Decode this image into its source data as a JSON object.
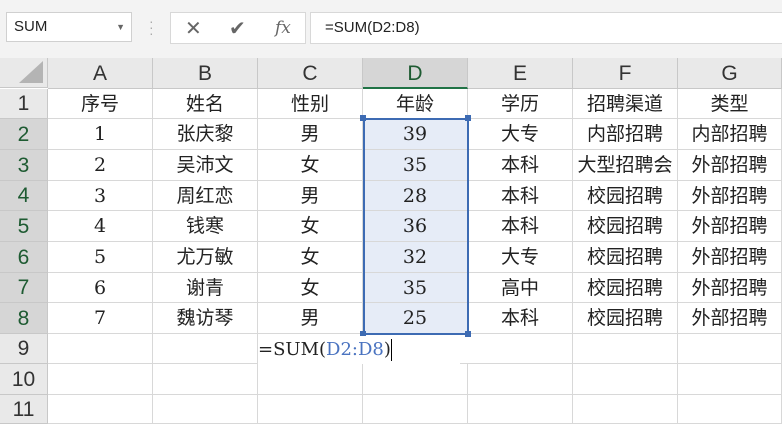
{
  "name_box": "SUM",
  "formula_bar": "=SUM(D2:D8)",
  "formula_buttons": {
    "cancel": "✕",
    "enter": "✔",
    "fx": "fx"
  },
  "columns": [
    "A",
    "B",
    "C",
    "D",
    "E",
    "F",
    "G"
  ],
  "rows": [
    "1",
    "2",
    "3",
    "4",
    "5",
    "6",
    "7",
    "8",
    "9",
    "10",
    "11"
  ],
  "table": [
    [
      "序号",
      "姓名",
      "性别",
      "年龄",
      "学历",
      "招聘渠道",
      "类型"
    ],
    [
      "1",
      "张庆黎",
      "男",
      "39",
      "大专",
      "内部招聘",
      "内部招聘"
    ],
    [
      "2",
      "吴沛文",
      "女",
      "35",
      "本科",
      "大型招聘会",
      "外部招聘"
    ],
    [
      "3",
      "周红恋",
      "男",
      "28",
      "本科",
      "校园招聘",
      "外部招聘"
    ],
    [
      "4",
      "钱寒",
      "女",
      "36",
      "本科",
      "校园招聘",
      "外部招聘"
    ],
    [
      "5",
      "尤万敏",
      "女",
      "32",
      "大专",
      "校园招聘",
      "外部招聘"
    ],
    [
      "6",
      "谢青",
      "女",
      "35",
      "高中",
      "校园招聘",
      "外部招聘"
    ],
    [
      "7",
      "魏访琴",
      "男",
      "25",
      "本科",
      "校园招聘",
      "外部招聘"
    ]
  ],
  "editing": {
    "prefix": "=SUM(",
    "ref": "D2:D8",
    "suffix": ")"
  }
}
